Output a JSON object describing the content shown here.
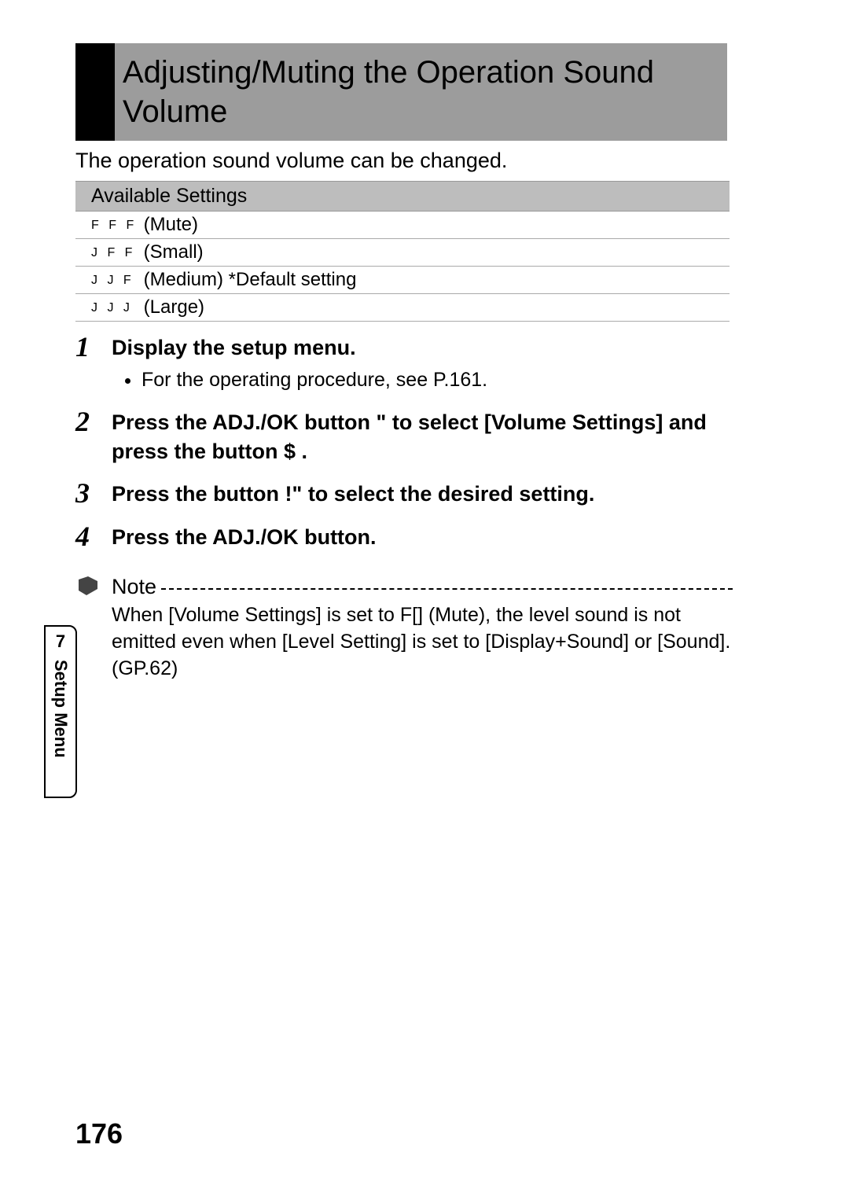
{
  "header": {
    "title": "Adjusting/Muting the Operation Sound Volume"
  },
  "intro": "The operation sound volume can be changed.",
  "settings": {
    "header": "Available Settings",
    "rows": [
      {
        "glyph": "F F F",
        "label": " (Mute)"
      },
      {
        "glyph": "J F F",
        "label": " (Small)"
      },
      {
        "glyph": "J J F",
        "label": " (Medium) *Default setting"
      },
      {
        "glyph": "J J J",
        "label": " (Large)"
      }
    ]
  },
  "steps": [
    {
      "title": "Display the setup menu.",
      "sub": "For the operating procedure, see P.161."
    },
    {
      "title": "Press the ADJ./OK button \"  to select [Volume Settings] and press the button $ ."
    },
    {
      "title": "Press the button !\"    to select the desired setting."
    },
    {
      "title": "Press the ADJ./OK button."
    }
  ],
  "note": {
    "label": "Note",
    "text": "When [Volume Settings] is set to F[] (Mute), the level sound is not emitted even when [Level Setting] is set to [Display+Sound] or [Sound]. (GP.62)"
  },
  "sidebar": {
    "chapter": "7",
    "label": "Setup Menu"
  },
  "pageNumber": "176"
}
